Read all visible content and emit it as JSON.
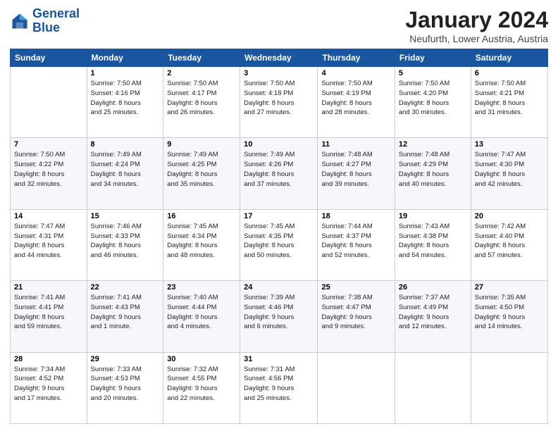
{
  "logo": {
    "line1": "General",
    "line2": "Blue"
  },
  "title": "January 2024",
  "location": "Neufurth, Lower Austria, Austria",
  "days_of_week": [
    "Sunday",
    "Monday",
    "Tuesday",
    "Wednesday",
    "Thursday",
    "Friday",
    "Saturday"
  ],
  "weeks": [
    [
      {
        "day": "",
        "info": ""
      },
      {
        "day": "1",
        "info": "Sunrise: 7:50 AM\nSunset: 4:16 PM\nDaylight: 8 hours\nand 25 minutes."
      },
      {
        "day": "2",
        "info": "Sunrise: 7:50 AM\nSunset: 4:17 PM\nDaylight: 8 hours\nand 26 minutes."
      },
      {
        "day": "3",
        "info": "Sunrise: 7:50 AM\nSunset: 4:18 PM\nDaylight: 8 hours\nand 27 minutes."
      },
      {
        "day": "4",
        "info": "Sunrise: 7:50 AM\nSunset: 4:19 PM\nDaylight: 8 hours\nand 28 minutes."
      },
      {
        "day": "5",
        "info": "Sunrise: 7:50 AM\nSunset: 4:20 PM\nDaylight: 8 hours\nand 30 minutes."
      },
      {
        "day": "6",
        "info": "Sunrise: 7:50 AM\nSunset: 4:21 PM\nDaylight: 8 hours\nand 31 minutes."
      }
    ],
    [
      {
        "day": "7",
        "info": "Sunrise: 7:50 AM\nSunset: 4:22 PM\nDaylight: 8 hours\nand 32 minutes."
      },
      {
        "day": "8",
        "info": "Sunrise: 7:49 AM\nSunset: 4:24 PM\nDaylight: 8 hours\nand 34 minutes."
      },
      {
        "day": "9",
        "info": "Sunrise: 7:49 AM\nSunset: 4:25 PM\nDaylight: 8 hours\nand 35 minutes."
      },
      {
        "day": "10",
        "info": "Sunrise: 7:49 AM\nSunset: 4:26 PM\nDaylight: 8 hours\nand 37 minutes."
      },
      {
        "day": "11",
        "info": "Sunrise: 7:48 AM\nSunset: 4:27 PM\nDaylight: 8 hours\nand 39 minutes."
      },
      {
        "day": "12",
        "info": "Sunrise: 7:48 AM\nSunset: 4:29 PM\nDaylight: 8 hours\nand 40 minutes."
      },
      {
        "day": "13",
        "info": "Sunrise: 7:47 AM\nSunset: 4:30 PM\nDaylight: 8 hours\nand 42 minutes."
      }
    ],
    [
      {
        "day": "14",
        "info": "Sunrise: 7:47 AM\nSunset: 4:31 PM\nDaylight: 8 hours\nand 44 minutes."
      },
      {
        "day": "15",
        "info": "Sunrise: 7:46 AM\nSunset: 4:33 PM\nDaylight: 8 hours\nand 46 minutes."
      },
      {
        "day": "16",
        "info": "Sunrise: 7:45 AM\nSunset: 4:34 PM\nDaylight: 8 hours\nand 48 minutes."
      },
      {
        "day": "17",
        "info": "Sunrise: 7:45 AM\nSunset: 4:35 PM\nDaylight: 8 hours\nand 50 minutes."
      },
      {
        "day": "18",
        "info": "Sunrise: 7:44 AM\nSunset: 4:37 PM\nDaylight: 8 hours\nand 52 minutes."
      },
      {
        "day": "19",
        "info": "Sunrise: 7:43 AM\nSunset: 4:38 PM\nDaylight: 8 hours\nand 54 minutes."
      },
      {
        "day": "20",
        "info": "Sunrise: 7:42 AM\nSunset: 4:40 PM\nDaylight: 8 hours\nand 57 minutes."
      }
    ],
    [
      {
        "day": "21",
        "info": "Sunrise: 7:41 AM\nSunset: 4:41 PM\nDaylight: 8 hours\nand 59 minutes."
      },
      {
        "day": "22",
        "info": "Sunrise: 7:41 AM\nSunset: 4:43 PM\nDaylight: 9 hours\nand 1 minute."
      },
      {
        "day": "23",
        "info": "Sunrise: 7:40 AM\nSunset: 4:44 PM\nDaylight: 9 hours\nand 4 minutes."
      },
      {
        "day": "24",
        "info": "Sunrise: 7:39 AM\nSunset: 4:46 PM\nDaylight: 9 hours\nand 6 minutes."
      },
      {
        "day": "25",
        "info": "Sunrise: 7:38 AM\nSunset: 4:47 PM\nDaylight: 9 hours\nand 9 minutes."
      },
      {
        "day": "26",
        "info": "Sunrise: 7:37 AM\nSunset: 4:49 PM\nDaylight: 9 hours\nand 12 minutes."
      },
      {
        "day": "27",
        "info": "Sunrise: 7:35 AM\nSunset: 4:50 PM\nDaylight: 9 hours\nand 14 minutes."
      }
    ],
    [
      {
        "day": "28",
        "info": "Sunrise: 7:34 AM\nSunset: 4:52 PM\nDaylight: 9 hours\nand 17 minutes."
      },
      {
        "day": "29",
        "info": "Sunrise: 7:33 AM\nSunset: 4:53 PM\nDaylight: 9 hours\nand 20 minutes."
      },
      {
        "day": "30",
        "info": "Sunrise: 7:32 AM\nSunset: 4:55 PM\nDaylight: 9 hours\nand 22 minutes."
      },
      {
        "day": "31",
        "info": "Sunrise: 7:31 AM\nSunset: 4:56 PM\nDaylight: 9 hours\nand 25 minutes."
      },
      {
        "day": "",
        "info": ""
      },
      {
        "day": "",
        "info": ""
      },
      {
        "day": "",
        "info": ""
      }
    ]
  ]
}
